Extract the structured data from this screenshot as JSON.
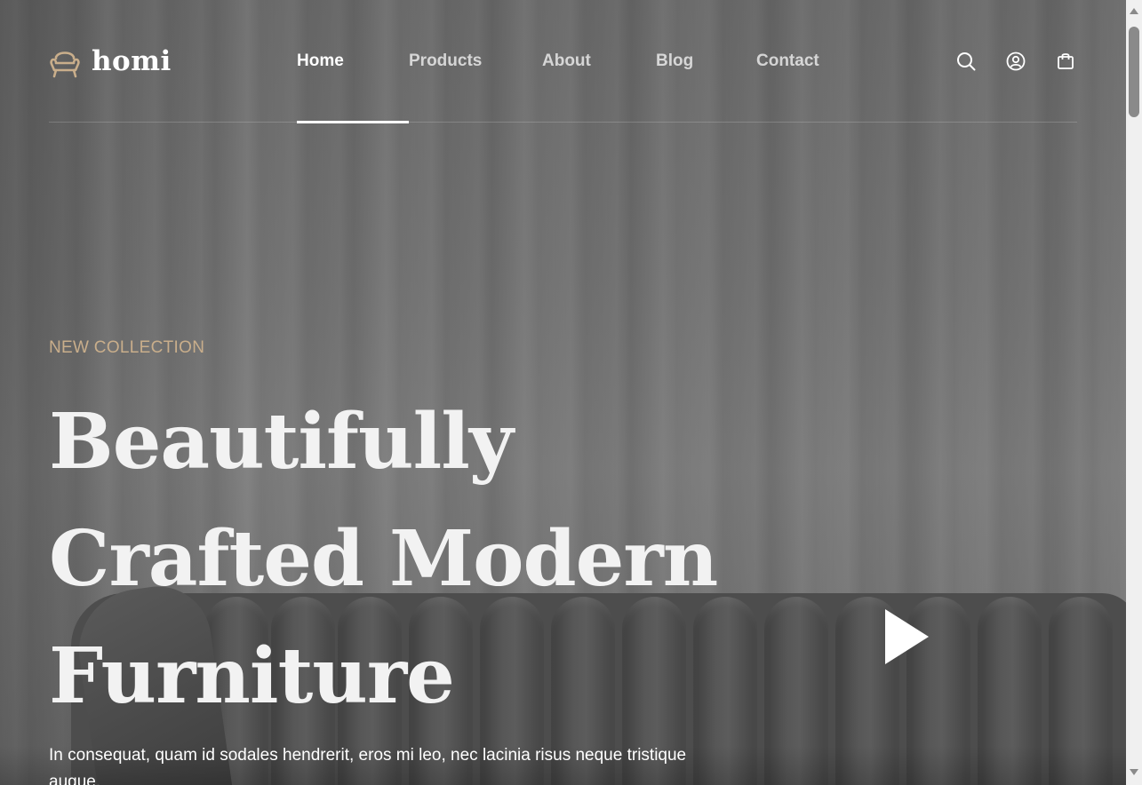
{
  "brand": {
    "name": "homi",
    "accent_color": "#c9ae8b"
  },
  "nav": {
    "items": [
      {
        "label": "Home",
        "active": true
      },
      {
        "label": "Products",
        "active": false
      },
      {
        "label": "About",
        "active": false
      },
      {
        "label": "Blog",
        "active": false
      },
      {
        "label": "Contact",
        "active": false
      }
    ]
  },
  "header_icons": [
    "search-icon",
    "user-icon",
    "shopping-bag-icon"
  ],
  "hero": {
    "eyebrow": "NEW COLLECTION",
    "headline_lines": [
      "Beautifully",
      "Crafted Modern",
      "Furniture"
    ],
    "lead": "In consequat, quam id sodales hendrerit, eros mi leo, nec lacinia risus neque tristique augue."
  },
  "video": {
    "icon": "play-icon"
  }
}
